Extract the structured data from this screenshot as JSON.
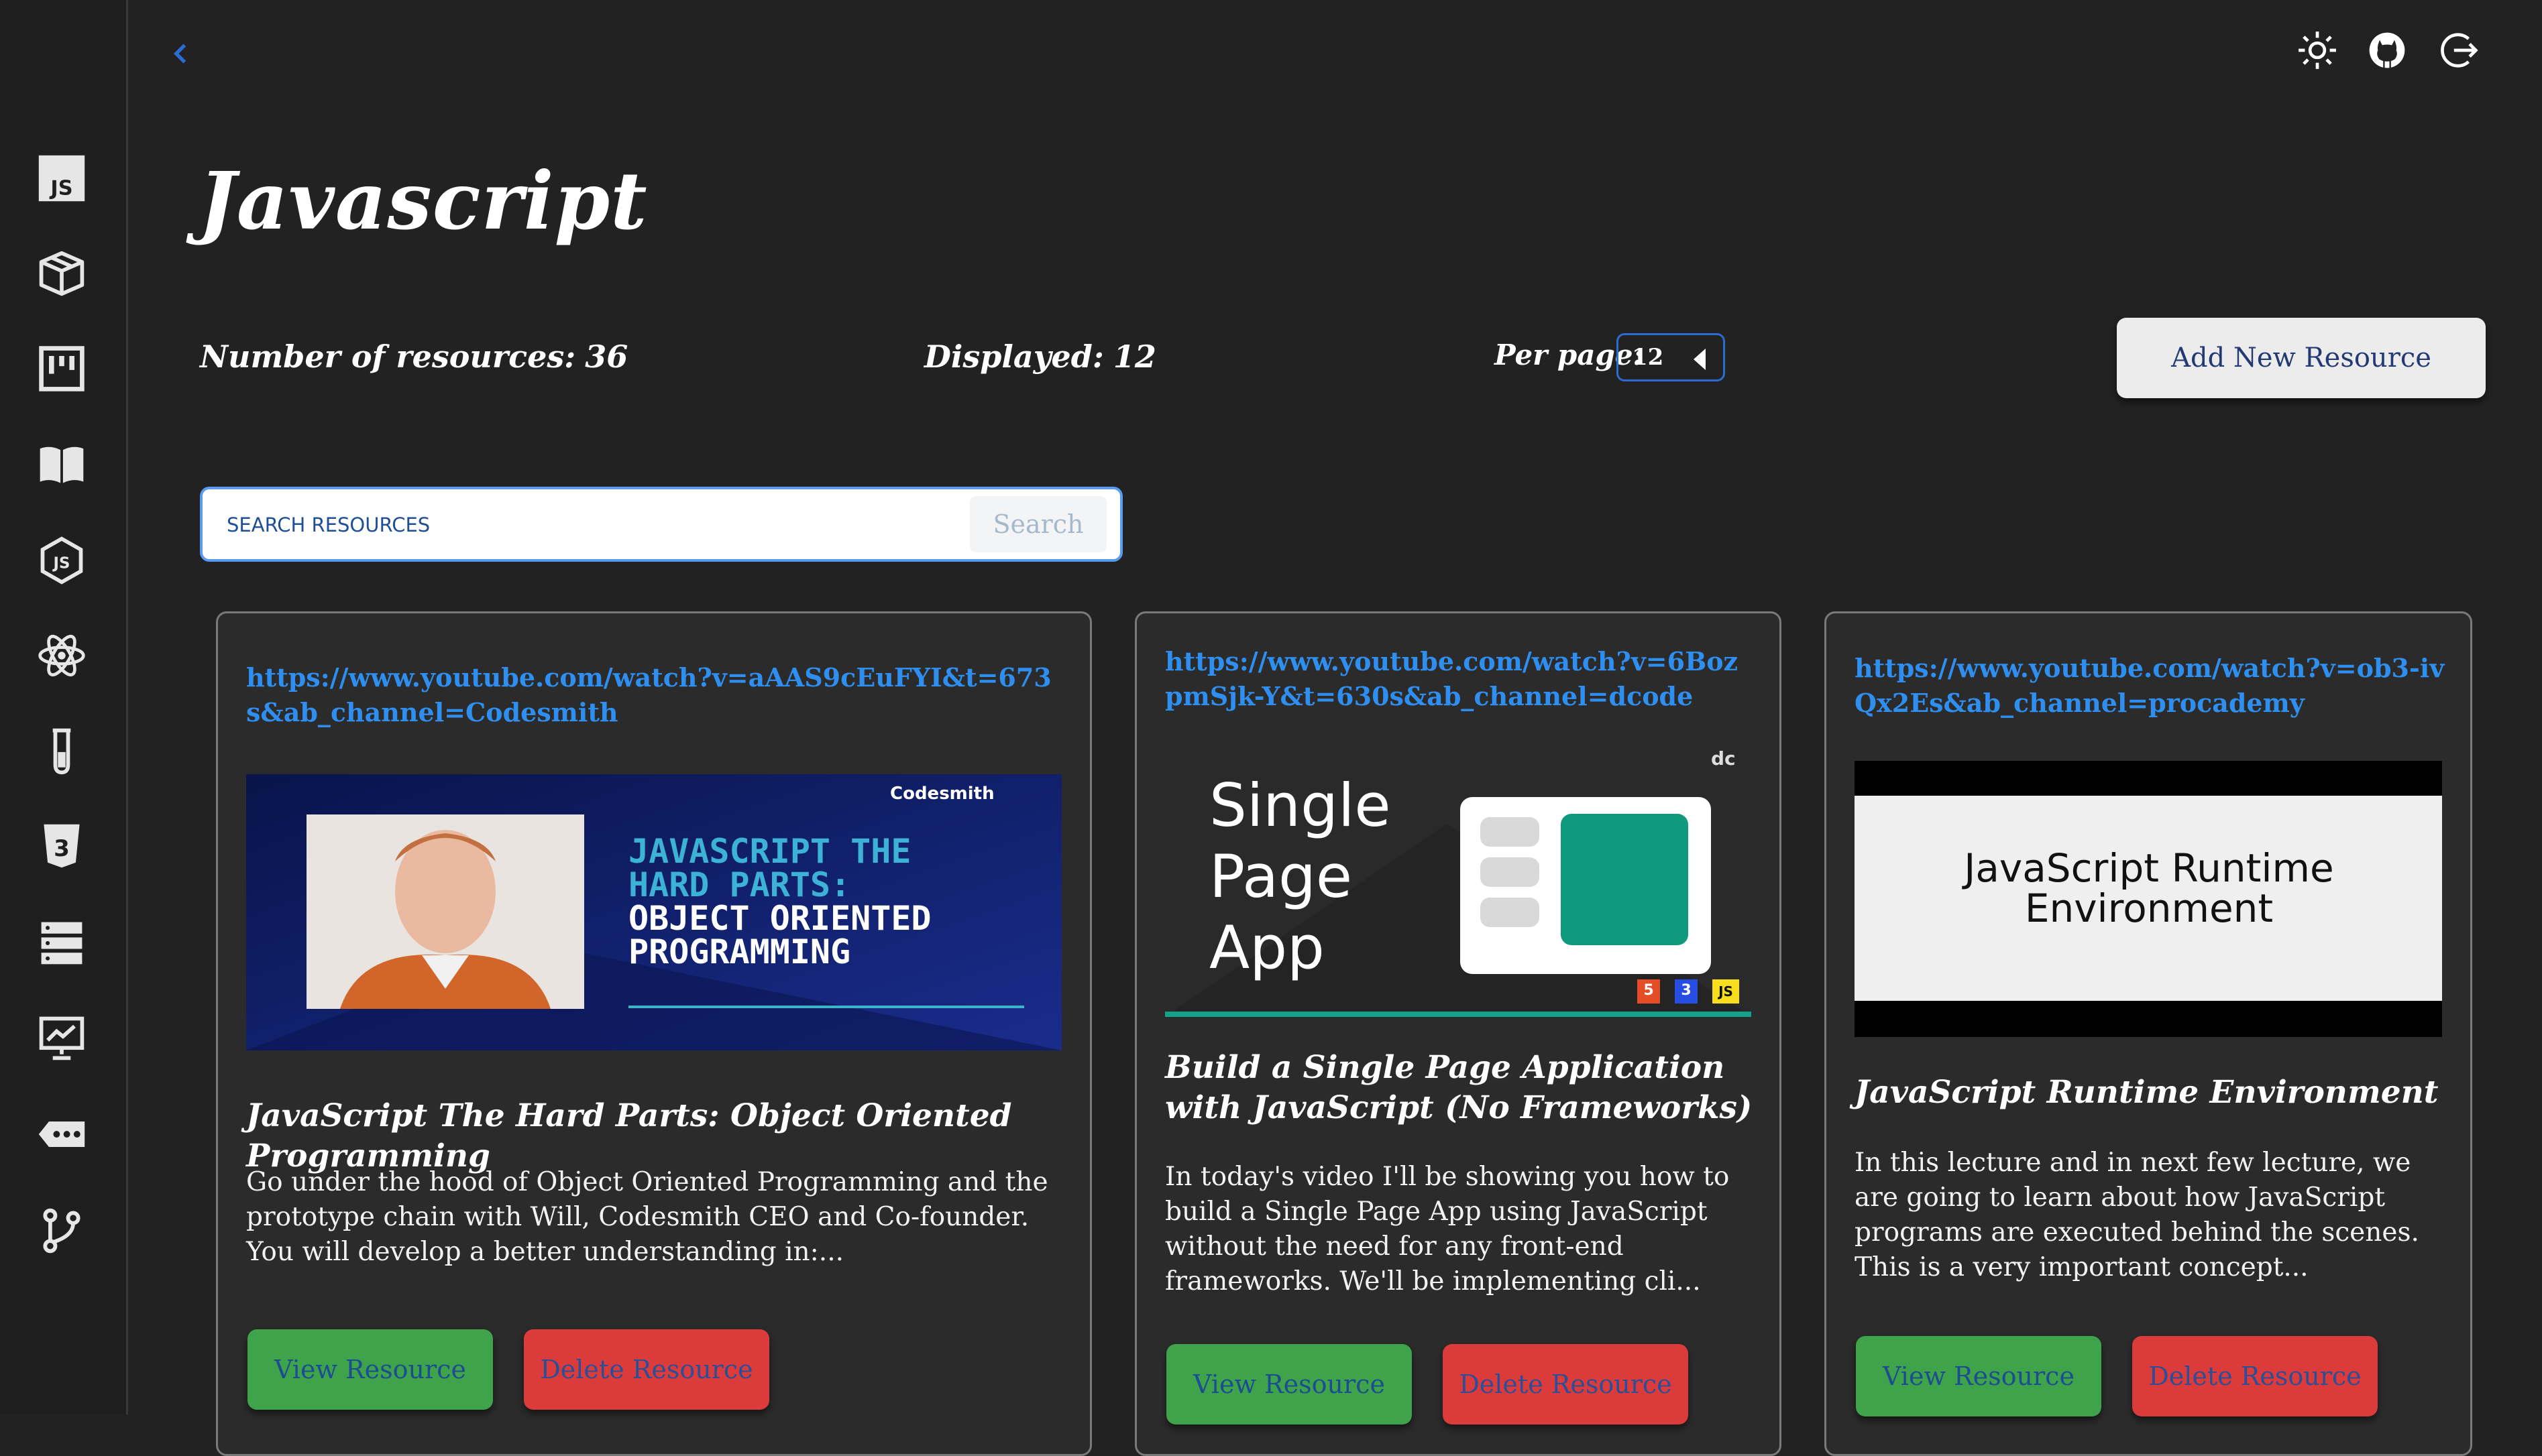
{
  "page": {
    "title": "Javascript",
    "resources_label": "Number of resources:",
    "resources_count": "36",
    "displayed_label": "Displayed:",
    "displayed_count": "12",
    "per_page_label": "Per page:",
    "per_page_value": "12",
    "add_button": "Add New Resource"
  },
  "search": {
    "placeholder": "SEARCH RESOURCES",
    "button": "Search"
  },
  "sidebar": {
    "items": [
      {
        "icon": "javascript-icon"
      },
      {
        "icon": "package-icon"
      },
      {
        "icon": "kanban-icon"
      },
      {
        "icon": "book-icon"
      },
      {
        "icon": "nodejs-icon"
      },
      {
        "icon": "react-icon"
      },
      {
        "icon": "test-tube-icon"
      },
      {
        "icon": "css3-icon"
      },
      {
        "icon": "server-icon"
      },
      {
        "icon": "presentation-icon"
      },
      {
        "icon": "ellipsis-tag-icon"
      },
      {
        "icon": "git-branch-icon"
      }
    ]
  },
  "topbar": {
    "icons": [
      "back-icon",
      "sun-icon",
      "github-icon",
      "logout-icon"
    ]
  },
  "cards": [
    {
      "url": "https://www.youtube.com/watch?v=aAAS9cEuFYI&t=673s&ab_channel=Codesmith",
      "thumb": {
        "brand": "Codesmith",
        "line1": "JAVASCRIPT THE",
        "line2": "HARD PARTS:",
        "line3": "OBJECT ORIENTED",
        "line4": "PROGRAMMING"
      },
      "title": "JavaScript The Hard Parts: Object Oriented Programming",
      "description": "Go under the hood of Object Oriented Programming and the prototype chain with Will, Codesmith CEO and Co-founder. You will develop a better understanding in:...",
      "view": "View Resource",
      "delete": "Delete Resource"
    },
    {
      "url": "https://www.youtube.com/watch?v=6BozpmSjk-Y&t=630s&ab_channel=dcode",
      "thumb": {
        "brand": "dc",
        "line1": "Single",
        "line2": "Page",
        "line3": "App",
        "badge1": "5",
        "badge2": "3",
        "badge3": "JS"
      },
      "title": "Build a Single Page Application with JavaScript (No Frameworks)",
      "description": "In today's video I'll be showing you how to build a Single Page App using JavaScript without the need for any front-end frameworks. We'll be implementing cli...",
      "view": "View Resource",
      "delete": "Delete Resource"
    },
    {
      "url": "https://www.youtube.com/watch?v=ob3-ivQx2Es&ab_channel=procademy",
      "thumb": {
        "line1": "JavaScript Runtime",
        "line2": "Environment"
      },
      "title": "JavaScript Runtime Environment",
      "description": "In this lecture and in next few lecture, we are going to learn about how JavaScript programs are executed behind the scenes. This is a very important concept...",
      "view": "View Resource",
      "delete": "Delete Resource"
    }
  ],
  "colors": {
    "background": "#222222",
    "link": "#2f8ff0",
    "view_button": "#3ea34a",
    "delete_button": "#dc3b3b",
    "select_border": "#2d6bd3"
  }
}
